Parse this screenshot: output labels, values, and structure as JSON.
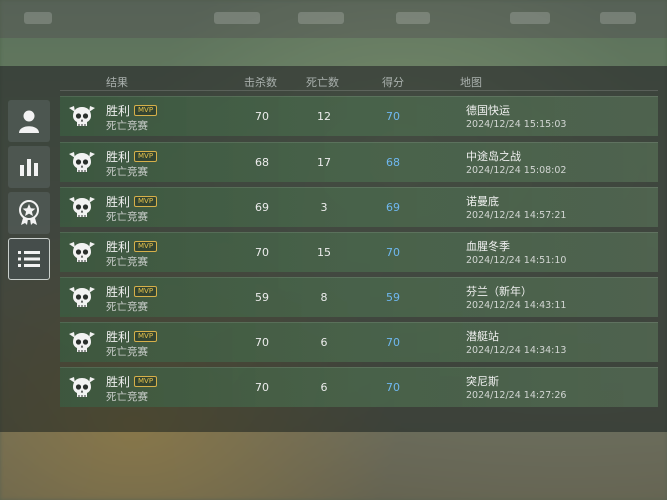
{
  "columns": {
    "result": "结果",
    "kills": "击杀数",
    "deaths": "死亡数",
    "score": "得分",
    "map": "地图"
  },
  "nav": [
    {
      "icon": "profile-icon"
    },
    {
      "icon": "stats-icon"
    },
    {
      "icon": "medal-icon"
    },
    {
      "icon": "match-list-icon",
      "active": true
    }
  ],
  "matches": [
    {
      "result": "胜利",
      "badge": "MVP",
      "mode": "死亡竞赛",
      "kills": "70",
      "deaths": "12",
      "score": "70",
      "map": "德国快运",
      "time": "2024/12/24 15:15:03"
    },
    {
      "result": "胜利",
      "badge": "MVP",
      "mode": "死亡竞赛",
      "kills": "68",
      "deaths": "17",
      "score": "68",
      "map": "中途岛之战",
      "time": "2024/12/24 15:08:02"
    },
    {
      "result": "胜利",
      "badge": "MVP",
      "mode": "死亡竞赛",
      "kills": "69",
      "deaths": "3",
      "score": "69",
      "map": "诺曼底",
      "time": "2024/12/24 14:57:21"
    },
    {
      "result": "胜利",
      "badge": "MVP",
      "mode": "死亡竞赛",
      "kills": "70",
      "deaths": "15",
      "score": "70",
      "map": "血腥冬季",
      "time": "2024/12/24 14:51:10"
    },
    {
      "result": "胜利",
      "badge": "MVP",
      "mode": "死亡竞赛",
      "kills": "59",
      "deaths": "8",
      "score": "59",
      "map": "芬兰（新年）",
      "time": "2024/12/24 14:43:11"
    },
    {
      "result": "胜利",
      "badge": "MVP",
      "mode": "死亡竞赛",
      "kills": "70",
      "deaths": "6",
      "score": "70",
      "map": "潜艇站",
      "time": "2024/12/24 14:34:13"
    },
    {
      "result": "胜利",
      "badge": "MVP",
      "mode": "死亡竞赛",
      "kills": "70",
      "deaths": "6",
      "score": "70",
      "map": "突尼斯",
      "time": "2024/12/24 14:27:26"
    }
  ],
  "colors": {
    "score": "#6fb8f0",
    "mvp": "#e6c24a",
    "row_bg": "#4a684c"
  }
}
